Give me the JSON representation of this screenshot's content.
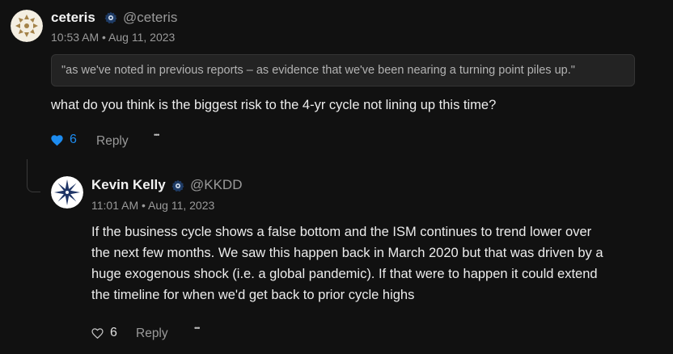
{
  "post": {
    "author_name": "ceteris",
    "author_handle": "@ceteris",
    "timestamp": "10:53 AM • Aug 11, 2023",
    "quote": "\"as we've noted in previous reports – as evidence that we've been nearing a turning point piles up.\"",
    "body": "what do you think is the biggest risk to the 4-yr cycle not lining up this time?",
    "like_count": "6",
    "liked": true,
    "reply_label": "Reply",
    "more_label": "•••",
    "avatar_icon": "geometric-logo-icon",
    "verified_icon": "verified-badge-icon"
  },
  "reply": {
    "author_name": "Kevin Kelly",
    "author_handle": "@KKDD",
    "timestamp": "11:01 AM • Aug 11, 2023",
    "body_lines": [
      "If the business cycle shows a false bottom and the ISM continues to trend lower over",
      "the next few months. We saw this happen back in March 2020 but that was driven by a",
      "huge exogenous shock (i.e. a global pandemic). If that were to happen it could extend",
      "the timeline for when we'd get back to prior cycle highs"
    ],
    "like_count": "6",
    "liked": false,
    "reply_label": "Reply",
    "more_label": "•••",
    "avatar_icon": "compass-star-logo-icon",
    "verified_icon": "verified-badge-icon"
  },
  "colors": {
    "background": "#111111",
    "liked_blue": "#1d8cf0",
    "muted": "#9a9a9a",
    "text": "#ececec"
  }
}
